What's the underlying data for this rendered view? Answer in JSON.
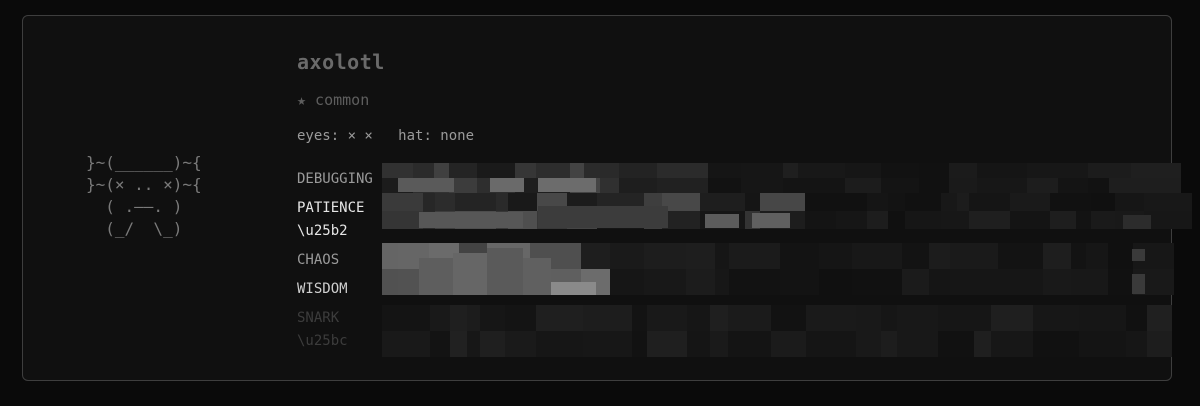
{
  "creature": {
    "name": "axolotl",
    "rarity": "★ common",
    "ascii": "}~(______)~{\n}~(× .. ×)~{\n  ( .––. )\n  (_/  \\_)",
    "eyes_label": "eyes: × ×",
    "hat_label": "hat: none"
  },
  "stats": [
    {
      "label": "DEBUGGING",
      "color": "#9a9a9a"
    },
    {
      "label": "PATIENCE",
      "color": "#e6e6e6"
    },
    {
      "label": "\\u25b2",
      "color": "#e6e6e6"
    },
    {
      "label": "CHAOS",
      "color": "#9a9a9a"
    },
    {
      "label": "WISDOM",
      "color": "#cfcfcf"
    },
    {
      "label": "SNARK",
      "color": "#3c3c3c"
    },
    {
      "label": "\\u25bc",
      "color": "#3c3c3c"
    }
  ],
  "colors": {
    "background": "#0a0a0a",
    "card": "#101010",
    "border": "#3e3e3e"
  }
}
